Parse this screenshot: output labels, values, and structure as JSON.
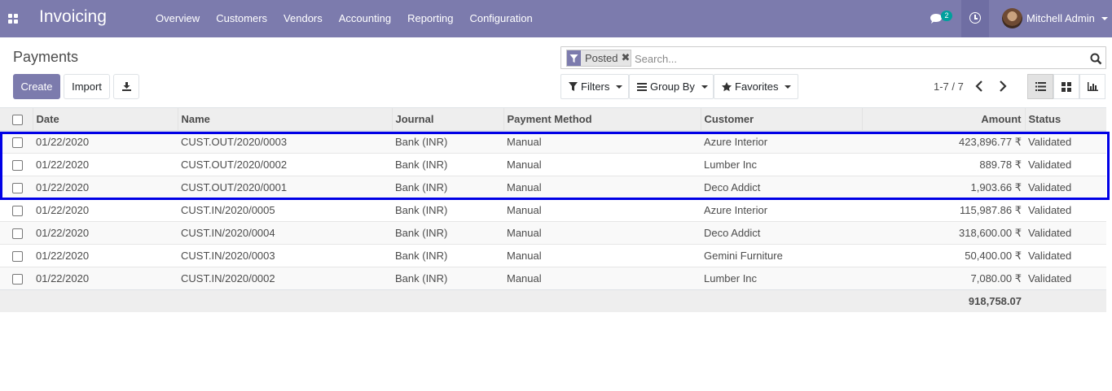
{
  "navbar": {
    "app_title": "Invoicing",
    "menu": [
      "Overview",
      "Customers",
      "Vendors",
      "Accounting",
      "Reporting",
      "Configuration"
    ],
    "chat_count": "2",
    "user_name": "Mitchell Admin",
    "bg_color": "#7c7bad"
  },
  "control_panel": {
    "breadcrumb": "Payments",
    "create_label": "Create",
    "import_label": "Import",
    "search": {
      "facet_value": "Posted",
      "placeholder": "Search..."
    },
    "filters_label": "Filters",
    "groupby_label": "Group By",
    "favorites_label": "Favorites",
    "pager": "1-7 / 7"
  },
  "table": {
    "columns": [
      "Date",
      "Name",
      "Journal",
      "Payment Method",
      "Customer",
      "Amount",
      "Status"
    ],
    "rows": [
      {
        "date": "01/22/2020",
        "name": "CUST.OUT/2020/0003",
        "journal": "Bank (INR)",
        "method": "Manual",
        "customer": "Azure Interior",
        "amount": "423,896.77 ₹",
        "status": "Validated"
      },
      {
        "date": "01/22/2020",
        "name": "CUST.OUT/2020/0002",
        "journal": "Bank (INR)",
        "method": "Manual",
        "customer": "Lumber Inc",
        "amount": "889.78 ₹",
        "status": "Validated"
      },
      {
        "date": "01/22/2020",
        "name": "CUST.OUT/2020/0001",
        "journal": "Bank (INR)",
        "method": "Manual",
        "customer": "Deco Addict",
        "amount": "1,903.66 ₹",
        "status": "Validated"
      },
      {
        "date": "01/22/2020",
        "name": "CUST.IN/2020/0005",
        "journal": "Bank (INR)",
        "method": "Manual",
        "customer": "Azure Interior",
        "amount": "115,987.86 ₹",
        "status": "Validated"
      },
      {
        "date": "01/22/2020",
        "name": "CUST.IN/2020/0004",
        "journal": "Bank (INR)",
        "method": "Manual",
        "customer": "Deco Addict",
        "amount": "318,600.00 ₹",
        "status": "Validated"
      },
      {
        "date": "01/22/2020",
        "name": "CUST.IN/2020/0003",
        "journal": "Bank (INR)",
        "method": "Manual",
        "customer": "Gemini Furniture",
        "amount": "50,400.00 ₹",
        "status": "Validated"
      },
      {
        "date": "01/22/2020",
        "name": "CUST.IN/2020/0002",
        "journal": "Bank (INR)",
        "method": "Manual",
        "customer": "Lumber Inc",
        "amount": "7,080.00 ₹",
        "status": "Validated"
      }
    ],
    "total_amount": "918,758.07"
  },
  "highlight_color": "#0000e6"
}
